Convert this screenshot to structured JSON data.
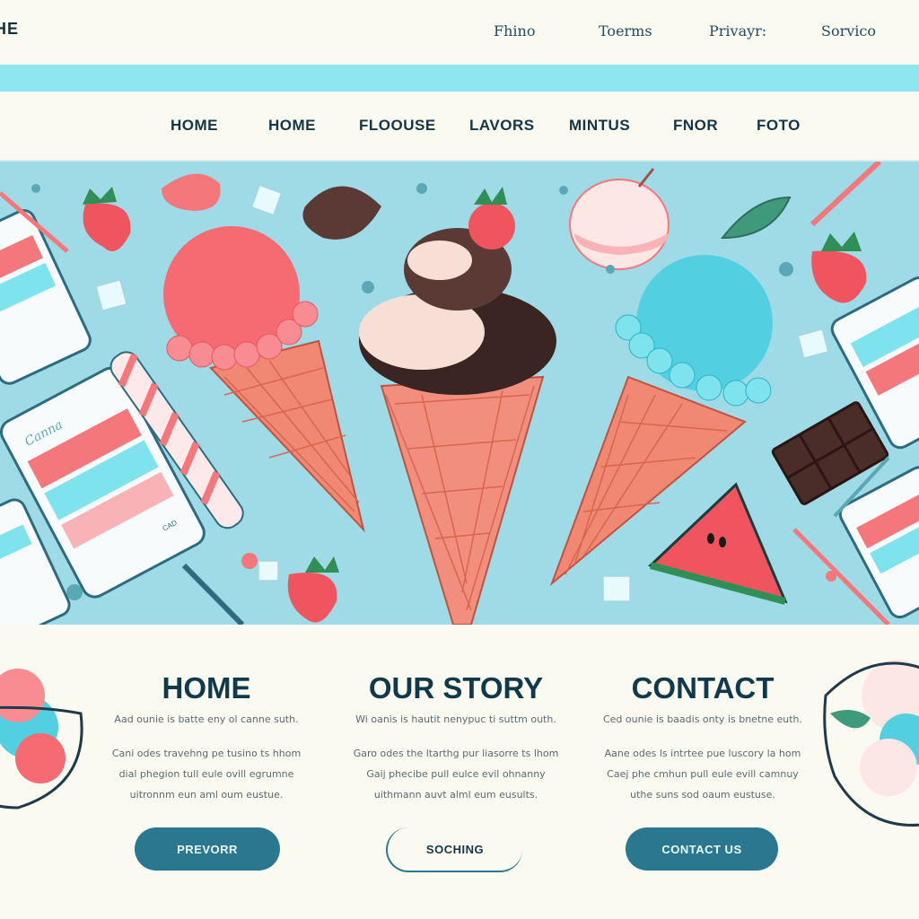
{
  "topbar": {
    "brand": "HE",
    "links": [
      "Fhino",
      "Toerms",
      "Privayr:",
      "Sorvico"
    ]
  },
  "nav": {
    "items": [
      "HOME",
      "HOME",
      "FLOOUSE",
      "LAVORS",
      "MINTUS",
      "FNOR",
      "FOTO"
    ]
  },
  "hero": {
    "phone_text": "Canna",
    "phone_small": "CAD"
  },
  "columns": [
    {
      "title": "HOME",
      "lead": "Aad ounie is batte eny ol canne suth.",
      "body": [
        "Cani odes travehng pe tusino ts hhom",
        "dial phegion tull eule ovill egrumne",
        "uitronnm eun aml oum eustue."
      ],
      "button": "PREVORR"
    },
    {
      "title": "OUR STORY",
      "lead": "Wi oanis is hautit nenypuc ti suttm outh.",
      "body": [
        "Garo odes the ltarthg pur liasorre ts lhom",
        "Gaij phecibe pull eulce evil ohnanny",
        "uithmann auvt alml eum eusults."
      ],
      "button": "SOCHING"
    },
    {
      "title": "CONTACT",
      "lead": "Ced ounie is baadis onty is bnetne euth.",
      "body": [
        "Aane odes ls intrtee pue luscory la hom",
        "Caej phe cmhun pull eule evill camnuy",
        "uthe suns sod oaum eustuse."
      ],
      "button": "CONTACT US"
    }
  ],
  "colors": {
    "accent_band": "#8ee6ee",
    "hero_bg": "#9fdbe6",
    "button": "#2a788f",
    "heading": "#0f3a4b",
    "pink": "#f4777c"
  }
}
